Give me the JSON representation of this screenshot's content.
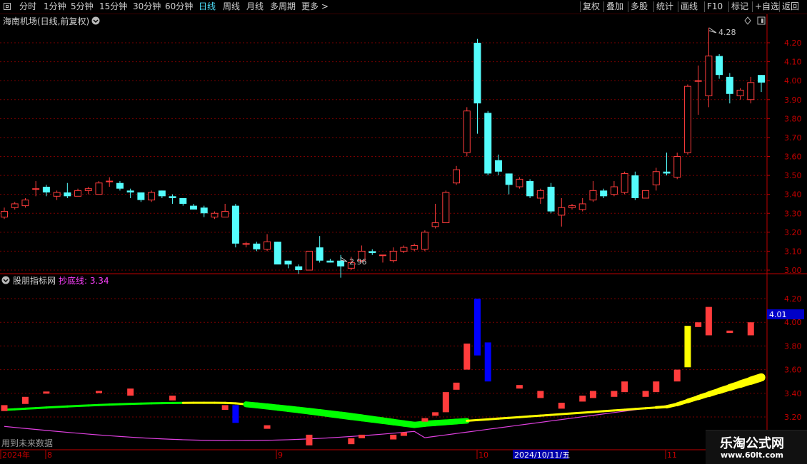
{
  "toolbar": {
    "tabs": [
      "分时",
      "1分钟",
      "5分钟",
      "15分钟",
      "30分钟",
      "60分钟",
      "日线",
      "周线",
      "月线",
      "多周期",
      "更多 >"
    ],
    "active_tab": "日线",
    "right_buttons": [
      "复权",
      "叠加",
      "多股",
      "统计",
      "画线",
      "F10",
      "标记",
      "+自选",
      "返回"
    ]
  },
  "main_panel": {
    "title": "海南机场(日线,前复权)",
    "high_label": "4.28",
    "low_label": "2.96",
    "y_ticks": [
      "4.20",
      "4.10",
      "4.00",
      "3.90",
      "3.80",
      "3.70",
      "3.60",
      "3.50",
      "3.40",
      "3.30",
      "3.20",
      "3.10",
      "3.00"
    ]
  },
  "indicator_panel": {
    "title": "股朋指标网",
    "line_label": "抄底线: 3.34",
    "y_ticks": [
      "4.20",
      "4.00",
      "3.80",
      "3.60",
      "3.40",
      "3.20"
    ],
    "value_tag": "4.01"
  },
  "x_axis": {
    "labels": [
      "2024年",
      "8",
      "9",
      "10",
      "11"
    ],
    "highlight": "2024/10/11/五",
    "note": "用到未来数据"
  },
  "watermark": {
    "title": "乐淘公式网",
    "url": "www.60lt.com"
  },
  "colors": {
    "up": "#ff3c3c",
    "down": "#54fcfc",
    "grid": "#7a0000",
    "yellow": "#ffff00",
    "green": "#00ff00",
    "magenta": "#e040e0",
    "blue": "#0000ff"
  },
  "chart_data": {
    "type": "candlestick",
    "symbol": "海南机场",
    "period": "日线",
    "ylim": [
      2.92,
      4.31
    ],
    "candles": [
      [
        3.28,
        3.31,
        3.33,
        3.27
      ],
      [
        3.33,
        3.35,
        3.36,
        3.32
      ],
      [
        3.34,
        3.37,
        3.38,
        3.33
      ],
      [
        3.43,
        3.43,
        3.47,
        3.39
      ],
      [
        3.44,
        3.41,
        3.45,
        3.39
      ],
      [
        3.39,
        3.41,
        3.42,
        3.37
      ],
      [
        3.41,
        3.39,
        3.46,
        3.38
      ],
      [
        3.39,
        3.42,
        3.43,
        3.39
      ],
      [
        3.42,
        3.43,
        3.44,
        3.4
      ],
      [
        3.4,
        3.46,
        3.47,
        3.4
      ],
      [
        3.47,
        3.47,
        3.49,
        3.44
      ],
      [
        3.46,
        3.43,
        3.47,
        3.42
      ],
      [
        3.42,
        3.41,
        3.43,
        3.38
      ],
      [
        3.41,
        3.37,
        3.41,
        3.36
      ],
      [
        3.37,
        3.41,
        3.42,
        3.36
      ],
      [
        3.42,
        3.39,
        3.42,
        3.38
      ],
      [
        3.39,
        3.38,
        3.4,
        3.35
      ],
      [
        3.38,
        3.35,
        3.38,
        3.34
      ],
      [
        3.34,
        3.32,
        3.35,
        3.32
      ],
      [
        3.33,
        3.3,
        3.34,
        3.28
      ],
      [
        3.28,
        3.3,
        3.31,
        3.27
      ],
      [
        3.28,
        3.31,
        3.35,
        3.28
      ],
      [
        3.34,
        3.14,
        3.35,
        3.12
      ],
      [
        3.14,
        3.14,
        3.15,
        3.12
      ],
      [
        3.14,
        3.11,
        3.15,
        3.1
      ],
      [
        3.11,
        3.15,
        3.19,
        3.1
      ],
      [
        3.15,
        3.03,
        3.15,
        3.03
      ],
      [
        3.05,
        3.03,
        3.05,
        3.01
      ],
      [
        3.02,
        3.0,
        3.03,
        2.98
      ],
      [
        3.0,
        3.1,
        3.1,
        3.0
      ],
      [
        3.12,
        3.05,
        3.18,
        3.04
      ],
      [
        3.05,
        3.04,
        3.06,
        3.04
      ],
      [
        3.05,
        3.02,
        3.08,
        2.96
      ],
      [
        3.01,
        3.04,
        3.07,
        3.0
      ],
      [
        3.05,
        3.1,
        3.13,
        3.04
      ],
      [
        3.1,
        3.09,
        3.11,
        3.08
      ],
      [
        3.08,
        3.08,
        3.08,
        3.04
      ],
      [
        3.05,
        3.1,
        3.12,
        3.04
      ],
      [
        3.1,
        3.12,
        3.13,
        3.09
      ],
      [
        3.11,
        3.13,
        3.14,
        3.1
      ],
      [
        3.11,
        3.2,
        3.21,
        3.1
      ],
      [
        3.23,
        3.25,
        3.35,
        3.22
      ],
      [
        3.25,
        3.41,
        3.42,
        3.25
      ],
      [
        3.46,
        3.53,
        3.55,
        3.45
      ],
      [
        3.62,
        3.84,
        3.86,
        3.6
      ],
      [
        4.2,
        3.88,
        4.22,
        3.72
      ],
      [
        3.83,
        3.51,
        3.84,
        3.5
      ],
      [
        3.58,
        3.52,
        3.61,
        3.5
      ],
      [
        3.51,
        3.45,
        3.51,
        3.4
      ],
      [
        3.44,
        3.48,
        3.49,
        3.43
      ],
      [
        3.47,
        3.39,
        3.48,
        3.38
      ],
      [
        3.38,
        3.42,
        3.43,
        3.35
      ],
      [
        3.44,
        3.31,
        3.46,
        3.3
      ],
      [
        3.29,
        3.33,
        3.38,
        3.23
      ],
      [
        3.33,
        3.34,
        3.35,
        3.32
      ],
      [
        3.32,
        3.35,
        3.38,
        3.31
      ],
      [
        3.37,
        3.42,
        3.47,
        3.36
      ],
      [
        3.42,
        3.39,
        3.43,
        3.38
      ],
      [
        3.4,
        3.44,
        3.47,
        3.39
      ],
      [
        3.41,
        3.51,
        3.52,
        3.4
      ],
      [
        3.5,
        3.38,
        3.52,
        3.37
      ],
      [
        3.38,
        3.42,
        3.42,
        3.38
      ],
      [
        3.45,
        3.52,
        3.54,
        3.42
      ],
      [
        3.52,
        3.51,
        3.62,
        3.5
      ],
      [
        3.49,
        3.6,
        3.62,
        3.48
      ],
      [
        3.62,
        3.97,
        3.98,
        3.61
      ],
      [
        4.0,
        4.0,
        4.08,
        3.82
      ],
      [
        3.92,
        4.13,
        4.28,
        3.86
      ],
      [
        4.13,
        4.03,
        4.14,
        4.01
      ],
      [
        4.02,
        3.93,
        4.04,
        3.88
      ],
      [
        3.92,
        3.95,
        3.96,
        3.9
      ],
      [
        3.9,
        3.99,
        4.02,
        3.88
      ],
      [
        4.03,
        3.99,
        4.03,
        3.94
      ]
    ],
    "indicator": {
      "name": "股朋指标网",
      "chaodi_line_last": 3.34,
      "ylim": [
        3.07,
        4.27
      ]
    }
  }
}
